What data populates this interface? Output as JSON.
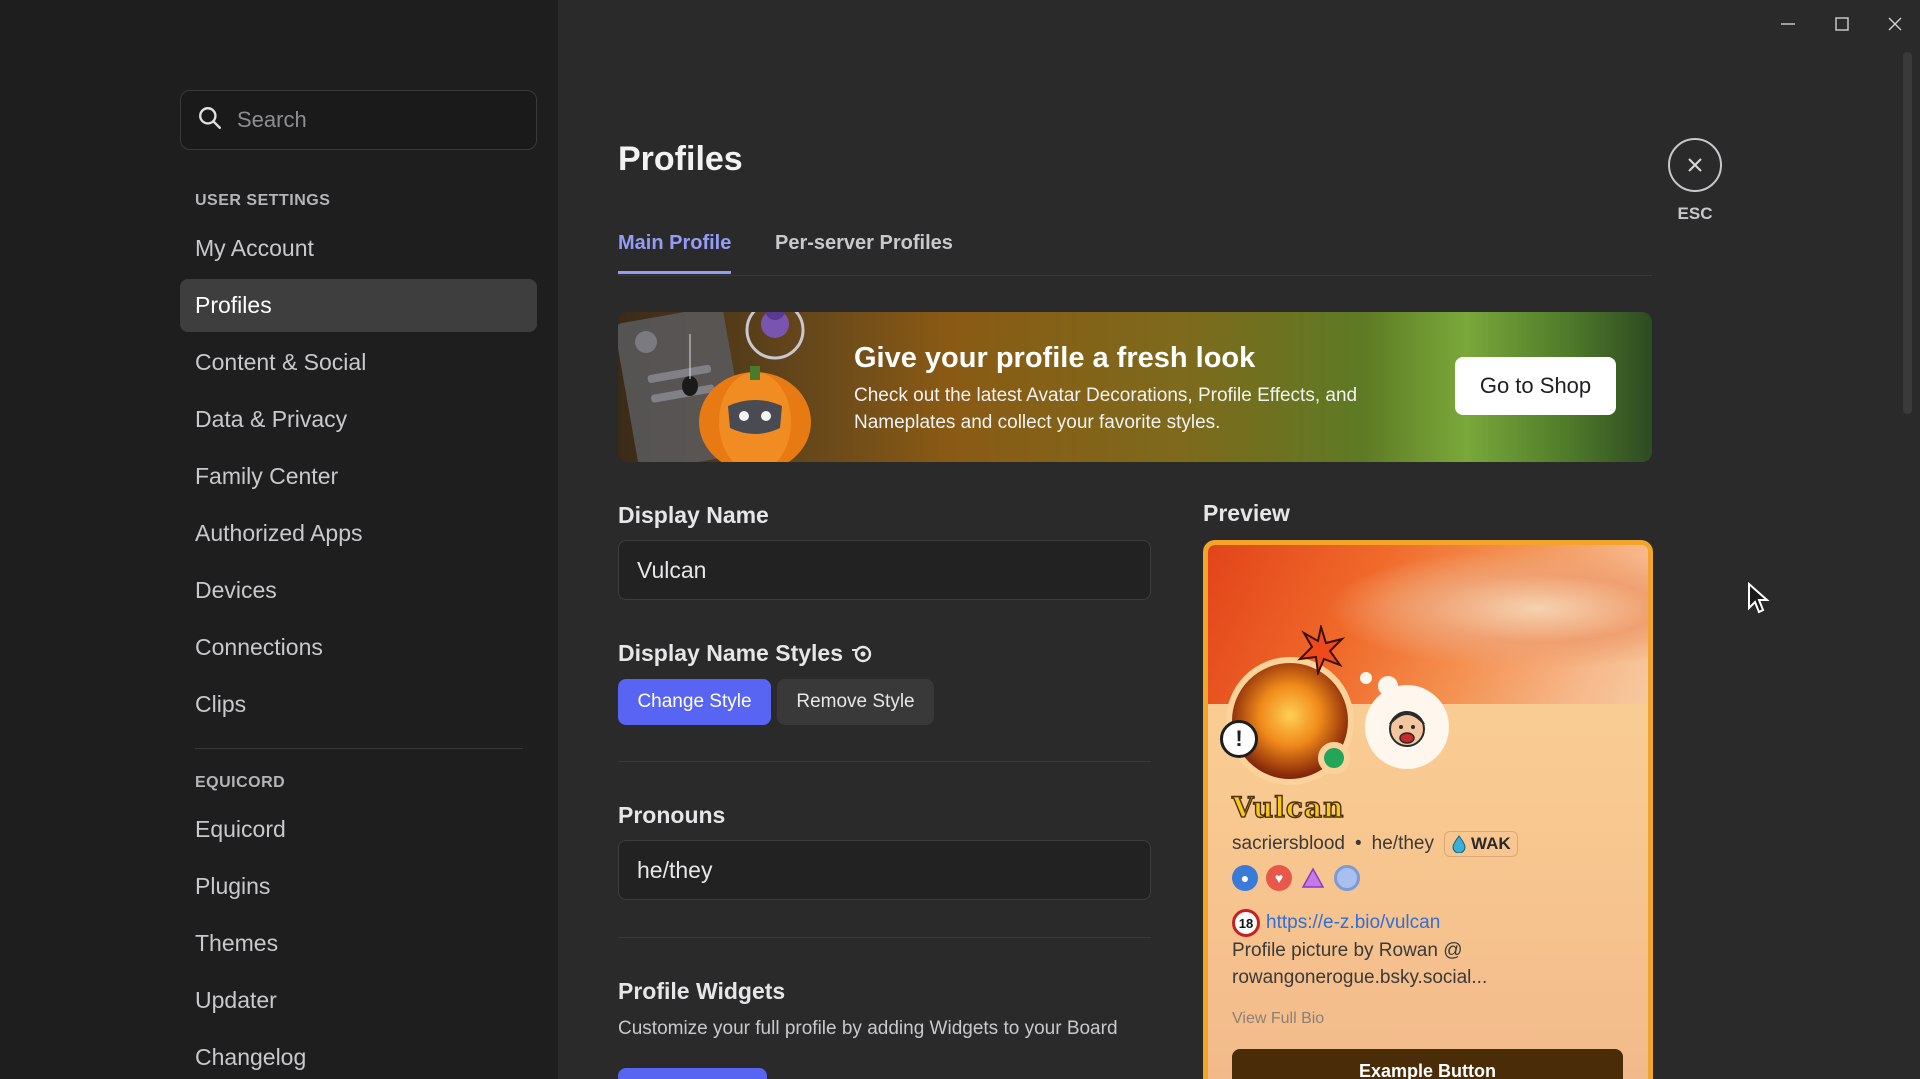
{
  "search": {
    "placeholder": "Search"
  },
  "sidebar": {
    "user_settings_header": "USER SETTINGS",
    "user_settings": [
      "My Account",
      "Profiles",
      "Content & Social",
      "Data & Privacy",
      "Family Center",
      "Authorized Apps",
      "Devices",
      "Connections",
      "Clips"
    ],
    "equicord_header": "EQUICORD",
    "equicord": [
      "Equicord",
      "Plugins",
      "Themes",
      "Updater",
      "Changelog"
    ],
    "active": "Profiles"
  },
  "page": {
    "title": "Profiles",
    "esc_label": "ESC",
    "tabs": [
      "Main Profile",
      "Per-server Profiles"
    ]
  },
  "banner": {
    "title": "Give your profile a fresh look",
    "text": "Check out the latest Avatar Decorations, Profile Effects, and Nameplates and collect your favorite styles.",
    "button": "Go to Shop"
  },
  "form": {
    "display_name_label": "Display Name",
    "display_name_value": "Vulcan",
    "display_name_styles_label": "Display Name Styles",
    "change_style": "Change Style",
    "remove_style": "Remove Style",
    "pronouns_label": "Pronouns",
    "pronouns_value": "he/they",
    "widgets_label": "Profile Widgets",
    "widgets_desc": "Customize your full profile by adding Widgets to your Board"
  },
  "preview": {
    "label": "Preview",
    "display_name": "Vulcan",
    "username": "sacriersblood",
    "separator": "•",
    "pronouns": "he/they",
    "tag": "WAK",
    "age_badge": "18",
    "bio_link": "https://e-z.bio/vulcan",
    "bio_text": "Profile picture by Rowan @ rowangonerogue.bsky.social...",
    "view_full_bio": "View Full Bio",
    "example_button": "Example Button"
  },
  "colors": {
    "accent": "#5865f2",
    "tab_active": "#949cf7",
    "card_border": "#f3a52a",
    "online": "#23a55a"
  }
}
